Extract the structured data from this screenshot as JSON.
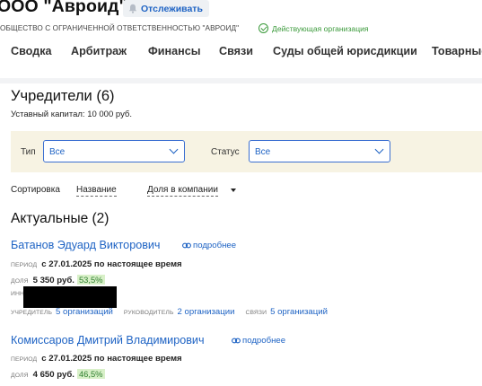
{
  "company": {
    "title": "ООО \"Авроид\"",
    "track_label": "Отслеживать",
    "full_name": "ОБЩЕСТВО С ОГРАНИЧЕННОЙ ОТВЕТСТВЕННОСТЬЮ \"АВРОИД\"",
    "status": "Действующая организация",
    "status_color": "#3b9a3b"
  },
  "tabs": [
    "Сводка",
    "Арбитраж",
    "Финансы",
    "Связи",
    "Суды общей юрисдикции",
    "Товарные"
  ],
  "section": {
    "title": "Учредители (6)",
    "capital": "Уставный капитал: 10 000 руб."
  },
  "filters": {
    "type_label": "Тип",
    "type_value": "Все",
    "status_label": "Статус",
    "status_value": "Все"
  },
  "sort": {
    "label": "Сортировка",
    "option_name": "Название",
    "option_share": "Доля в компании"
  },
  "group_title": "Актуальные (2)",
  "founders": [
    {
      "name": "Батанов Эдуард Викторович",
      "more": "подробнее",
      "period_label": "ПЕРИОД",
      "period": "с 27.01.2025 по настоящее время",
      "share_label": "ДОЛЯ",
      "share": "5 350 руб.",
      "share_pct": "53,5%",
      "inn_label": "ИНН",
      "founder_label": "УЧРЕДИТЕЛЬ",
      "founder_link": "5 организаций",
      "head_label": "РУКОВОДИТЕЛЬ",
      "head_link": "2 организации",
      "links_label": "СВЯЗИ",
      "links_link": "5 организаций"
    },
    {
      "name": "Комиссаров Дмитрий Владимирович",
      "more": "подробнее",
      "period_label": "ПЕРИОД",
      "period": "с 27.01.2025 по настоящее время",
      "share_label": "ДОЛЯ",
      "share": "4 650 руб.",
      "share_pct": "46,5%"
    }
  ],
  "colors": {
    "accent": "#1e63c4",
    "share_badge_bg": "#d8f0c8",
    "filter_bg": "#f7f3e3"
  }
}
